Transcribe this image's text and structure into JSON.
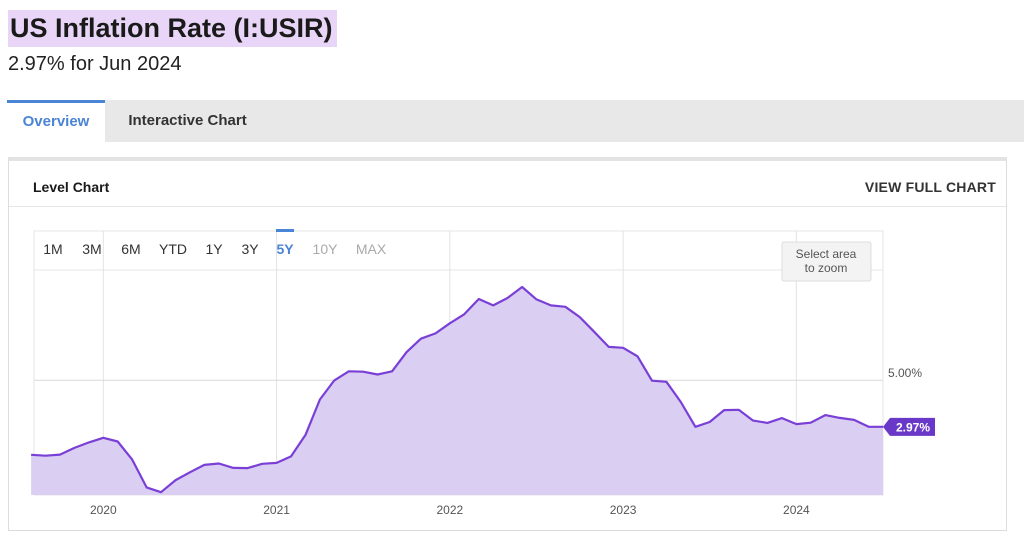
{
  "page": {
    "title": "US Inflation Rate (I:USIR)",
    "subtitle": "2.97% for Jun 2024"
  },
  "tabs": [
    {
      "label": "Overview",
      "active": true
    },
    {
      "label": "Interactive Chart",
      "active": false
    }
  ],
  "panel": {
    "title": "Level Chart",
    "view_full_label": "VIEW FULL CHART"
  },
  "colors": {
    "accent": "#4a84d6",
    "series_line": "#7a3fd6",
    "series_fill": "#d8ccf2",
    "current_badge": "#6a38c9"
  },
  "range_selector": {
    "options": [
      {
        "label": "1M",
        "state": "enabled"
      },
      {
        "label": "3M",
        "state": "enabled"
      },
      {
        "label": "6M",
        "state": "enabled"
      },
      {
        "label": "YTD",
        "state": "enabled"
      },
      {
        "label": "1Y",
        "state": "enabled"
      },
      {
        "label": "3Y",
        "state": "enabled"
      },
      {
        "label": "5Y",
        "state": "selected"
      },
      {
        "label": "10Y",
        "state": "disabled"
      },
      {
        "label": "MAX",
        "state": "disabled"
      }
    ]
  },
  "zoom_hint": [
    "Select area",
    "to zoom"
  ],
  "chart_data": {
    "type": "area",
    "grid": true,
    "xlim": [
      2019.6,
      2024.5
    ],
    "ylim": [
      0,
      11.5
    ],
    "x_ticks": [
      {
        "value": 2020.0,
        "label": "2020"
      },
      {
        "value": 2021.0,
        "label": "2021"
      },
      {
        "value": 2022.0,
        "label": "2022"
      },
      {
        "value": 2023.0,
        "label": "2023"
      },
      {
        "value": 2024.0,
        "label": "2024"
      }
    ],
    "y_ticks": [
      {
        "value": 5.0,
        "label": "5.00%"
      }
    ],
    "current_value_label": "2.97%",
    "series": [
      {
        "x": [
          2019.583,
          2019.667,
          2019.75,
          2019.833,
          2019.917,
          2020.0,
          2020.083,
          2020.167,
          2020.25,
          2020.333,
          2020.417,
          2020.5,
          2020.583,
          2020.667,
          2020.75,
          2020.833,
          2020.917,
          2021.0,
          2021.083,
          2021.167,
          2021.25,
          2021.333,
          2021.417,
          2021.5,
          2021.583,
          2021.667,
          2021.75,
          2021.833,
          2021.917,
          2022.0,
          2022.083,
          2022.167,
          2022.25,
          2022.333,
          2022.417,
          2022.5,
          2022.583,
          2022.667,
          2022.75,
          2022.833,
          2022.917,
          2023.0,
          2023.083,
          2023.167,
          2023.25,
          2023.333,
          2023.417,
          2023.5,
          2023.583,
          2023.667,
          2023.75,
          2023.833,
          2023.917,
          2024.0,
          2024.083,
          2024.167,
          2024.25,
          2024.333,
          2024.417,
          2024.5
        ],
        "y": [
          1.75,
          1.71,
          1.76,
          2.05,
          2.29,
          2.49,
          2.33,
          1.54,
          0.33,
          0.12,
          0.65,
          0.99,
          1.31,
          1.37,
          1.18,
          1.17,
          1.36,
          1.4,
          1.68,
          2.62,
          4.16,
          4.99,
          5.39,
          5.37,
          5.25,
          5.39,
          6.22,
          6.81,
          7.04,
          7.48,
          7.87,
          8.54,
          8.26,
          8.58,
          9.06,
          8.52,
          8.26,
          8.2,
          7.75,
          7.11,
          6.45,
          6.41,
          6.04,
          4.98,
          4.93,
          4.05,
          2.97,
          3.18,
          3.7,
          3.71,
          3.24,
          3.14,
          3.35,
          3.09,
          3.15,
          3.48,
          3.36,
          3.27,
          2.97,
          2.97
        ]
      }
    ]
  }
}
